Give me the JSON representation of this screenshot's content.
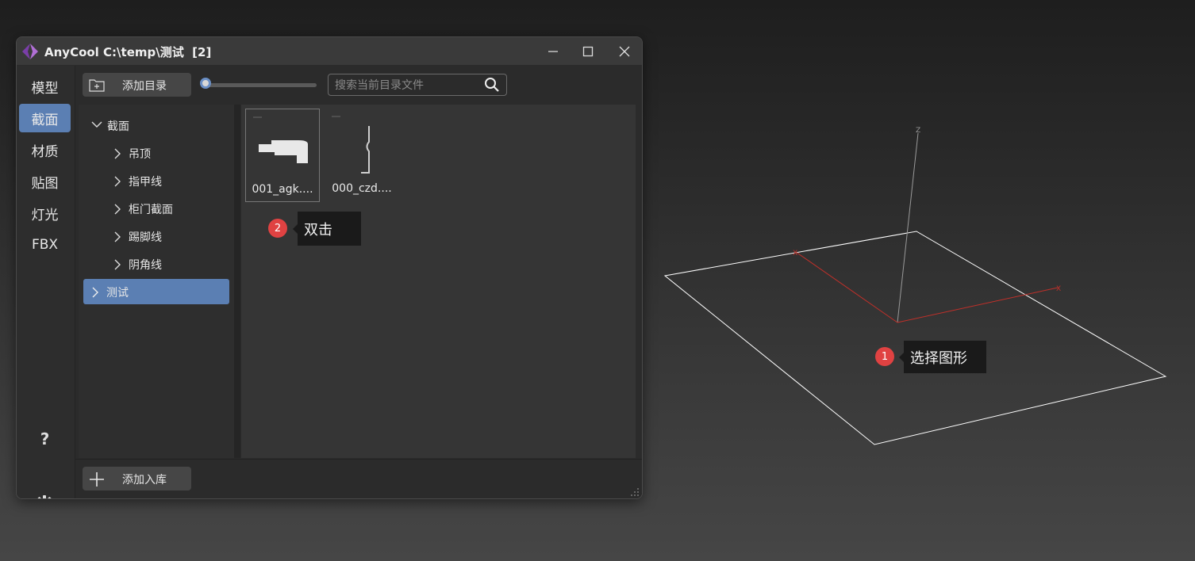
{
  "window": {
    "title": "AnyCool C:\\temp\\测试  [2]"
  },
  "sidebar": {
    "items": [
      {
        "label": "模型",
        "active": false
      },
      {
        "label": "截面",
        "active": true
      },
      {
        "label": "材质",
        "active": false
      },
      {
        "label": "贴图",
        "active": false
      },
      {
        "label": "灯光",
        "active": false
      },
      {
        "label": "FBX",
        "active": false
      }
    ],
    "help_label": "?"
  },
  "toolbar": {
    "add_dir_label": "添加目录",
    "search_placeholder": "搜索当前目录文件",
    "zoom_slider_value": 0
  },
  "tree": {
    "root_label": "截面",
    "children": [
      "吊顶",
      "指甲线",
      "柜门截面",
      "踢脚线",
      "阴角线"
    ],
    "selected_label": "测试"
  },
  "files": [
    {
      "name": "001_agk....",
      "selected": true
    },
    {
      "name": "000_czd....",
      "selected": false
    }
  ],
  "bottom": {
    "add_lib_label": "添加入库"
  },
  "annotations": [
    {
      "number": "1",
      "text": "选择图形"
    },
    {
      "number": "2",
      "text": "双击"
    }
  ],
  "viewport": {
    "axis_z_label": "Z",
    "axis_x_label": "X",
    "axis_color": "#c0302a",
    "outline_color": "#ffffff"
  },
  "colors": {
    "accent": "#5b7fb3",
    "badge": "#e04242"
  }
}
